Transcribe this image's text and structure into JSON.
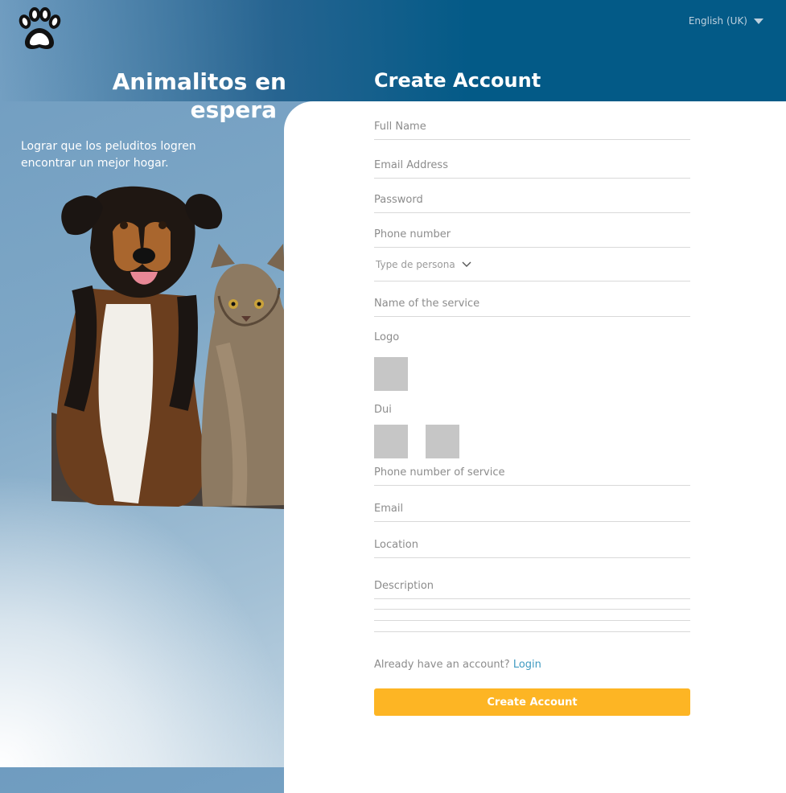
{
  "header": {
    "language": "English (UK)"
  },
  "hero": {
    "title_line1": "Animalitos en",
    "title_line2": "espera",
    "subtitle": "Lograr que los peluditos logren encontrar un mejor hogar."
  },
  "form": {
    "title": "Create Account",
    "fields": {
      "full_name": "Full Name",
      "email_address": "Email Address",
      "password": "Password",
      "phone_number": "Phone number",
      "type_persona": "Type de persona",
      "service_name": "Name of the service",
      "logo": "Logo",
      "dui": "Dui",
      "service_phone": "Phone number of service",
      "email": "Email",
      "location": "Location",
      "description": "Description"
    },
    "login_prompt": "Already have an account?",
    "login_link": "Login",
    "submit": "Create Account"
  },
  "colors": {
    "header": "#035a87",
    "accent": "#fdb524",
    "link": "#3f9ac1"
  }
}
